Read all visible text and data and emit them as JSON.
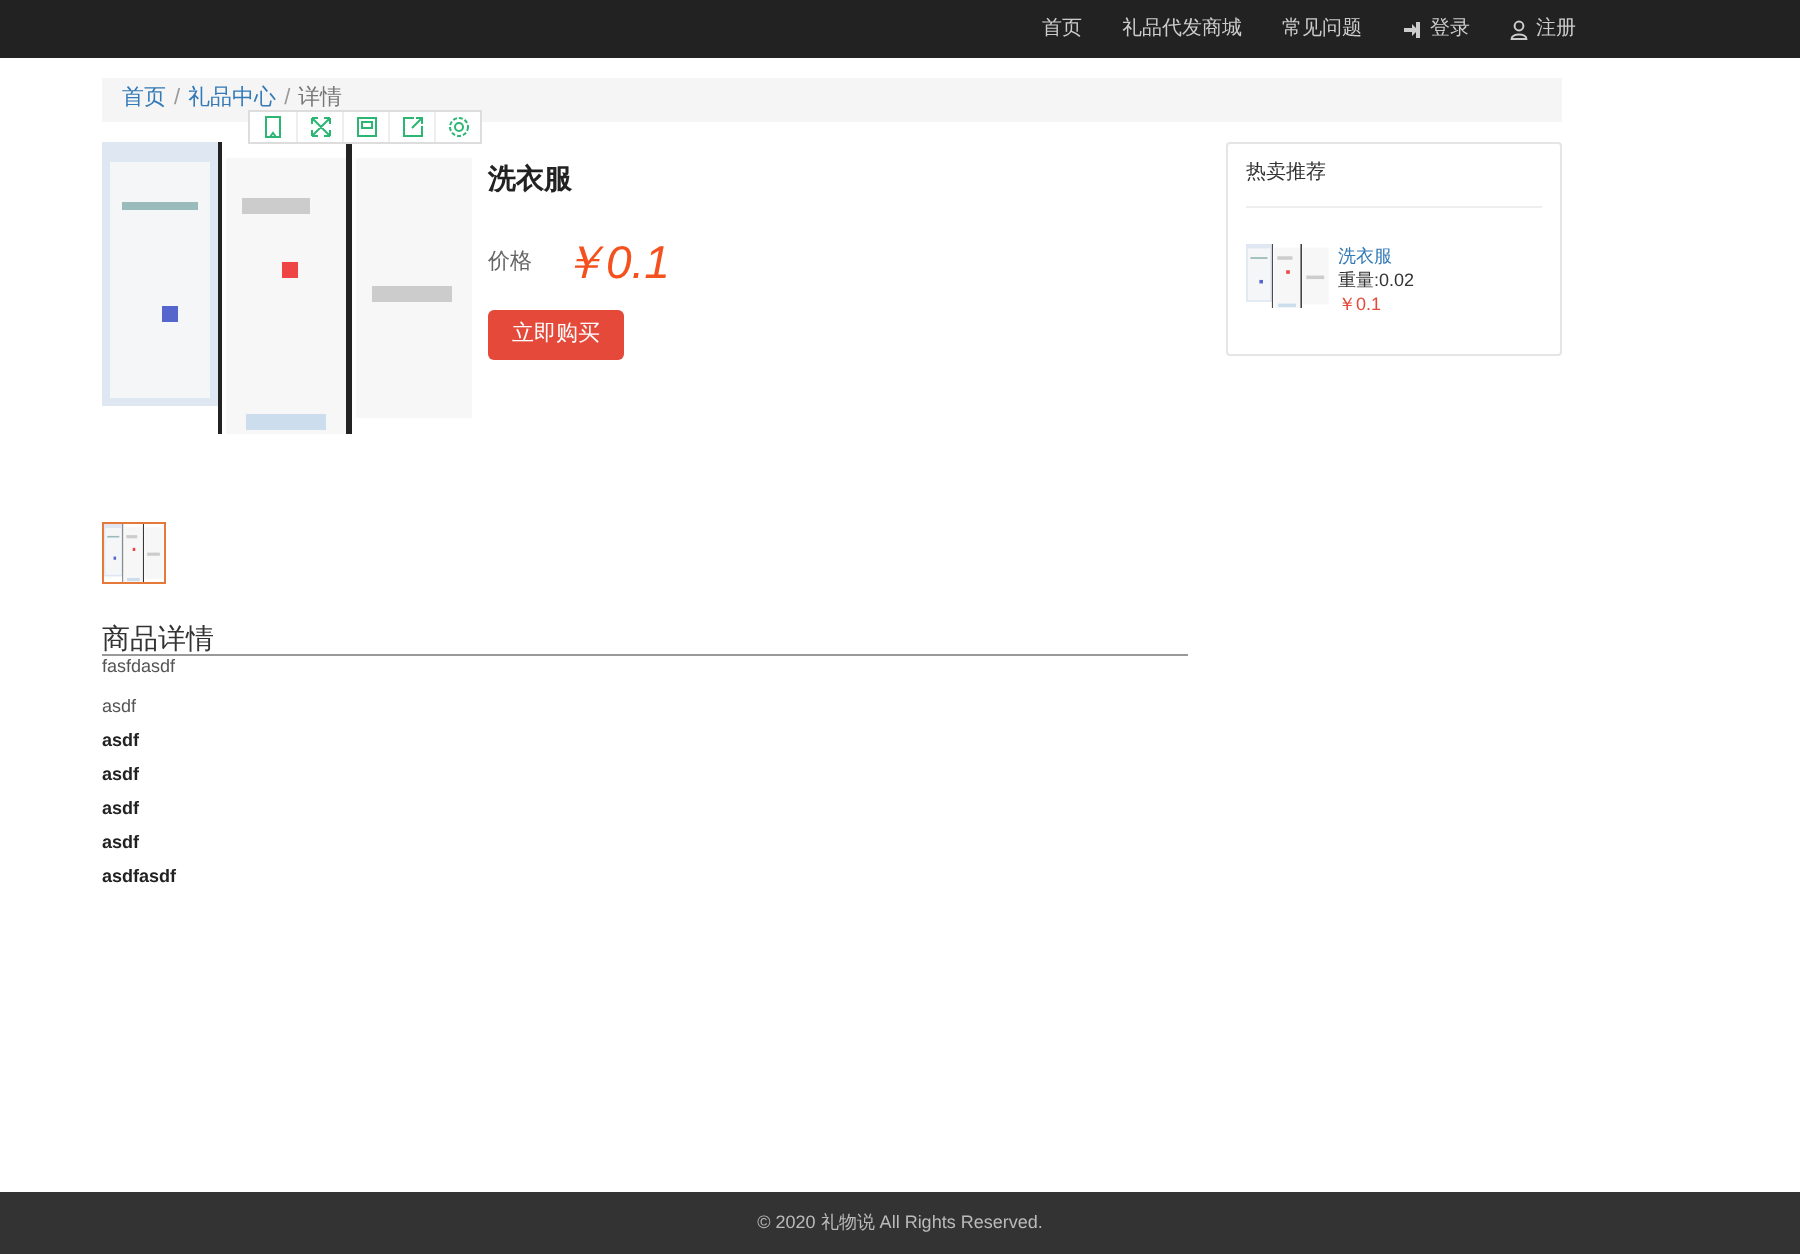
{
  "nav": {
    "links": [
      {
        "label": "首页",
        "kind": "plain"
      },
      {
        "label": "礼品代发商城",
        "kind": "plain"
      },
      {
        "label": "常见问题",
        "kind": "plain"
      },
      {
        "label": "登录",
        "kind": "login"
      },
      {
        "label": "注册",
        "kind": "register"
      }
    ]
  },
  "breadcrumb": {
    "separator": "/",
    "items": [
      {
        "label": "首页",
        "current": false
      },
      {
        "label": "礼品中心",
        "current": false
      },
      {
        "label": "详情",
        "current": true
      }
    ]
  },
  "product": {
    "title": "洗衣服",
    "price_label": "价格",
    "price": "￥0.1",
    "buy_button": "立即购买"
  },
  "thumbnails": [
    {
      "selected": true
    }
  ],
  "hot": {
    "title": "热卖推荐",
    "items": [
      {
        "name": "洗衣服",
        "weight": "重量:0.02",
        "price": "￥0.1"
      }
    ]
  },
  "details": {
    "title": "商品详情",
    "lines": [
      {
        "text": "fasfdasdf",
        "bold": false
      },
      {
        "text": "asdf",
        "bold": false
      },
      {
        "text": "asdf",
        "bold": true
      },
      {
        "text": "asdf",
        "bold": true
      },
      {
        "text": "asdf",
        "bold": true
      },
      {
        "text": "asdf",
        "bold": true
      },
      {
        "text": "asdfasdf",
        "bold": true
      }
    ]
  },
  "footer": "© 2020 礼物说 All Rights Reserved."
}
